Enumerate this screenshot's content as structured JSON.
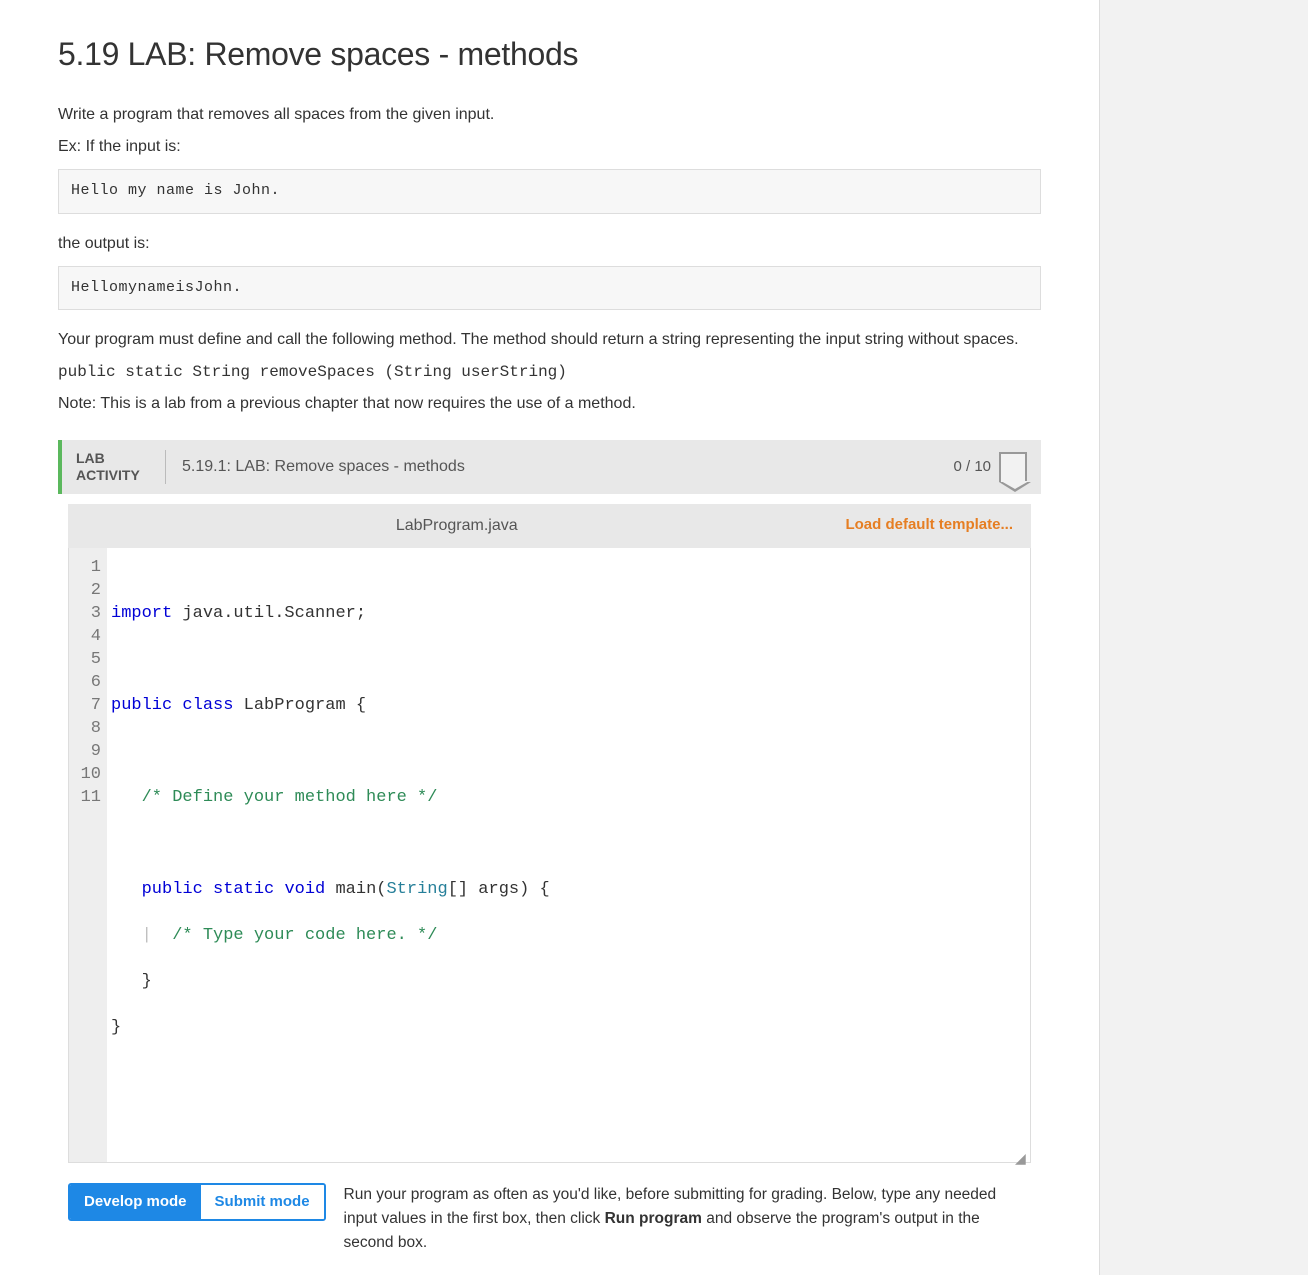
{
  "title": "5.19 LAB: Remove spaces - methods",
  "intro": "Write a program that removes all spaces from the given input.",
  "ex_if_input": "Ex: If the input is:",
  "input_example": "Hello my name is John.",
  "output_is": "the output is:",
  "output_example": "HellomynameisJohn.",
  "method_instruction": "Your program must define and call the following method. The method should return a string representing the input string without spaces.",
  "method_signature": "public static String removeSpaces (String userString)",
  "note": "Note: This is a lab from a previous chapter that now requires the use of a method.",
  "lab": {
    "label": "LAB ACTIVITY",
    "title": "5.19.1: LAB: Remove spaces - methods",
    "score": "0 / 10",
    "filename": "LabProgram.java",
    "load_template": "Load default template...",
    "lines": [
      "1",
      "2",
      "3",
      "4",
      "5",
      "6",
      "7",
      "8",
      "9",
      "10",
      "11"
    ],
    "code": {
      "l1_kw": "import",
      "l1_rest": " java.util.Scanner;",
      "l3_kw1": "public",
      "l3_kw2": "class",
      "l3_name": " LabProgram {",
      "l5_comment": "/* Define your method here */",
      "l7_kw1": "public",
      "l7_kw2": "static",
      "l7_kw3": "void",
      "l7_main": " main(",
      "l7_type": "String",
      "l7_after": "[] args) {",
      "l8_comment": "/* Type your code here. */",
      "l9": "   }",
      "l10": "}"
    },
    "mode": {
      "develop": "Develop mode",
      "submit": "Submit mode",
      "desc_before": "Run your program as often as you'd like, before submitting for grading. Below, type any needed input values in the first box, then click ",
      "desc_bold": "Run program",
      "desc_after": " and observe the program's output in the second box."
    }
  }
}
